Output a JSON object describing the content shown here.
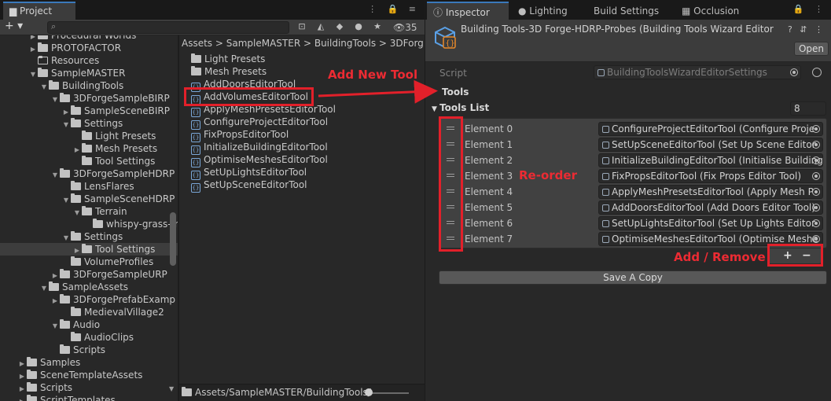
{
  "project": {
    "tab_label": "Project",
    "window_icons": "⋮ 🔒 ≡",
    "plus_label": "+ ▾",
    "search_placeholder": "",
    "toolbar_icons": [
      "⊡",
      "◭",
      "◆",
      "●",
      "★"
    ],
    "hidden_count": "35",
    "tree": [
      {
        "label": "Procedural Worlds",
        "depth": 2,
        "arrow": "▶",
        "empty": false,
        "selected": false
      },
      {
        "label": "PROTOFACTOR",
        "depth": 2,
        "arrow": "▶",
        "empty": false,
        "selected": false
      },
      {
        "label": "Resources",
        "depth": 2,
        "arrow": "",
        "empty": true,
        "selected": false
      },
      {
        "label": "SampleMASTER",
        "depth": 2,
        "arrow": "▼",
        "empty": false,
        "selected": false
      },
      {
        "label": "BuildingTools",
        "depth": 3,
        "arrow": "▼",
        "empty": false,
        "selected": false
      },
      {
        "label": "3DForgeSampleBIRP",
        "depth": 4,
        "arrow": "▼",
        "empty": false,
        "selected": false
      },
      {
        "label": "SampleSceneBIRP",
        "depth": 5,
        "arrow": "▶",
        "empty": false,
        "selected": false
      },
      {
        "label": "Settings",
        "depth": 5,
        "arrow": "▼",
        "empty": false,
        "selected": false
      },
      {
        "label": "Light Presets",
        "depth": 6,
        "arrow": "",
        "empty": false,
        "selected": false
      },
      {
        "label": "Mesh Presets",
        "depth": 6,
        "arrow": "▶",
        "empty": false,
        "selected": false
      },
      {
        "label": "Tool Settings",
        "depth": 6,
        "arrow": "",
        "empty": false,
        "selected": false
      },
      {
        "label": "3DForgeSampleHDRP",
        "depth": 4,
        "arrow": "▼",
        "empty": false,
        "selected": false
      },
      {
        "label": "LensFlares",
        "depth": 5,
        "arrow": "",
        "empty": false,
        "selected": false
      },
      {
        "label": "SampleSceneHDRP",
        "depth": 5,
        "arrow": "▼",
        "empty": false,
        "selected": false
      },
      {
        "label": "Terrain",
        "depth": 6,
        "arrow": "▼",
        "empty": false,
        "selected": false
      },
      {
        "label": "whispy-grass-m",
        "depth": 7,
        "arrow": "",
        "empty": false,
        "selected": false
      },
      {
        "label": "Settings",
        "depth": 5,
        "arrow": "▼",
        "empty": false,
        "selected": false
      },
      {
        "label": "Tool Settings",
        "depth": 6,
        "arrow": "▶",
        "empty": false,
        "selected": true
      },
      {
        "label": "VolumeProfiles",
        "depth": 5,
        "arrow": "",
        "empty": false,
        "selected": false
      },
      {
        "label": "3DForgeSampleURP",
        "depth": 4,
        "arrow": "▶",
        "empty": false,
        "selected": false
      },
      {
        "label": "SampleAssets",
        "depth": 3,
        "arrow": "▼",
        "empty": false,
        "selected": false
      },
      {
        "label": "3DForgePrefabExamp",
        "depth": 4,
        "arrow": "▶",
        "empty": false,
        "selected": false
      },
      {
        "label": "MedievalVillage2",
        "depth": 5,
        "arrow": "",
        "empty": false,
        "selected": false
      },
      {
        "label": "Audio",
        "depth": 4,
        "arrow": "▼",
        "empty": false,
        "selected": false
      },
      {
        "label": "AudioClips",
        "depth": 5,
        "arrow": "",
        "empty": false,
        "selected": false
      },
      {
        "label": "Scripts",
        "depth": 4,
        "arrow": "",
        "empty": false,
        "selected": false
      },
      {
        "label": "Samples",
        "depth": 1,
        "arrow": "▶",
        "empty": false,
        "selected": false
      },
      {
        "label": "SceneTemplateAssets",
        "depth": 1,
        "arrow": "▶",
        "empty": false,
        "selected": false
      },
      {
        "label": "Scripts",
        "depth": 1,
        "arrow": "▶",
        "empty": false,
        "selected": false
      },
      {
        "label": "ScriptTemplates",
        "depth": 1,
        "arrow": "▶",
        "empty": false,
        "selected": false
      }
    ],
    "breadcrumb": "Assets > SampleMASTER > BuildingTools > 3DForg",
    "assets": [
      {
        "label": "Light Presets",
        "kind": "folder"
      },
      {
        "label": "Mesh Presets",
        "kind": "folder"
      },
      {
        "label": "AddDoorsEditorTool",
        "kind": "script"
      },
      {
        "label": "AddVolumesEditorTool",
        "kind": "script"
      },
      {
        "label": "ApplyMeshPresetsEditorTool",
        "kind": "script"
      },
      {
        "label": "ConfigureProjectEditorTool",
        "kind": "script"
      },
      {
        "label": "FixPropsEditorTool",
        "kind": "script"
      },
      {
        "label": "InitializeBuildingEditorTool",
        "kind": "script"
      },
      {
        "label": "OptimiseMeshesEditorTool",
        "kind": "script"
      },
      {
        "label": "SetUpLightsEditorTool",
        "kind": "script"
      },
      {
        "label": "SetUpSceneEditorTool",
        "kind": "script"
      }
    ],
    "status_path": "Assets/SampleMASTER/BuildingTools/",
    "zoom_level": 0
  },
  "inspector": {
    "tabs": [
      {
        "label": "ⓘ Inspector",
        "active": true
      },
      {
        "label": "● Lighting",
        "active": false
      },
      {
        "label": "Build Settings",
        "active": false
      },
      {
        "label": "▦ Occlusion",
        "active": false
      }
    ],
    "window_icons": "🔒 ⋮",
    "title": "Building Tools-3D Forge-HDRP-Probes (Building Tools Wizard Editor",
    "header_icons": "? ⇵ ⋮",
    "open_label": "Open",
    "script_label": "Script",
    "script_value": "BuildingToolsWizardEditorSettings",
    "tools_label": "Tools",
    "tools_list_label": "Tools List",
    "tools_count": "8",
    "elements": [
      {
        "label": "Element 0",
        "value": "ConfigureProjectEditorTool (Configure Proje"
      },
      {
        "label": "Element 1",
        "value": "SetUpSceneEditorTool (Set Up Scene Editor"
      },
      {
        "label": "Element 2",
        "value": "InitializeBuildingEditorTool (Initialise Building"
      },
      {
        "label": "Element 3",
        "value": "FixPropsEditorTool (Fix Props Editor Tool)"
      },
      {
        "label": "Element 4",
        "value": "ApplyMeshPresetsEditorTool (Apply Mesh P"
      },
      {
        "label": "Element 5",
        "value": "AddDoorsEditorTool (Add Doors Editor Tool)"
      },
      {
        "label": "Element 6",
        "value": "SetUpLightsEditorTool (Set Up Lights Editor"
      },
      {
        "label": "Element 7",
        "value": "OptimiseMeshesEditorTool (Optimise Meshe"
      }
    ],
    "add_label": "+",
    "remove_label": "−",
    "save_copy_label": "Save A Copy"
  },
  "annotations": {
    "add_new_tool": "Add New Tool",
    "reorder": "Re-order",
    "add_remove": "Add / Remove"
  },
  "colors": {
    "accent": "#3a79bb",
    "annotation_red": "#e2202a",
    "panel_bg": "#282828",
    "field_bg": "#2a2a2a"
  }
}
